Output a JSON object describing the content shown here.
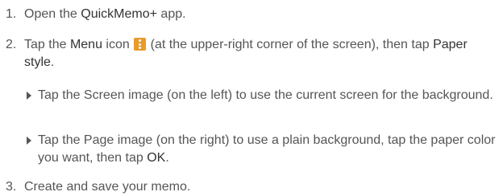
{
  "steps": [
    {
      "num": "1.",
      "pre": "Open the ",
      "app": "QuickMemo+",
      "post": " app."
    },
    {
      "num": "2.",
      "pre": "Tap the ",
      "menu": "Menu",
      "mid": " icon ",
      "icon": "menu-vertical-dots-icon",
      "post": " (at the upper-right corner of the screen), then tap ",
      "option": "Paper style",
      "end": "."
    },
    {
      "num": "3.",
      "text": "Create and save your memo."
    }
  ],
  "substeps": [
    {
      "text": "Tap the Screen image (on the left) to use the current screen for the background."
    },
    {
      "pre": "Tap the Page image (on the right) to use a plain background, tap the paper color you want, then tap ",
      "ok": "OK",
      "post": "."
    }
  ],
  "colors": {
    "text": "#555555",
    "emphasis": "#333333",
    "icon_bg": "#e89a2a"
  }
}
